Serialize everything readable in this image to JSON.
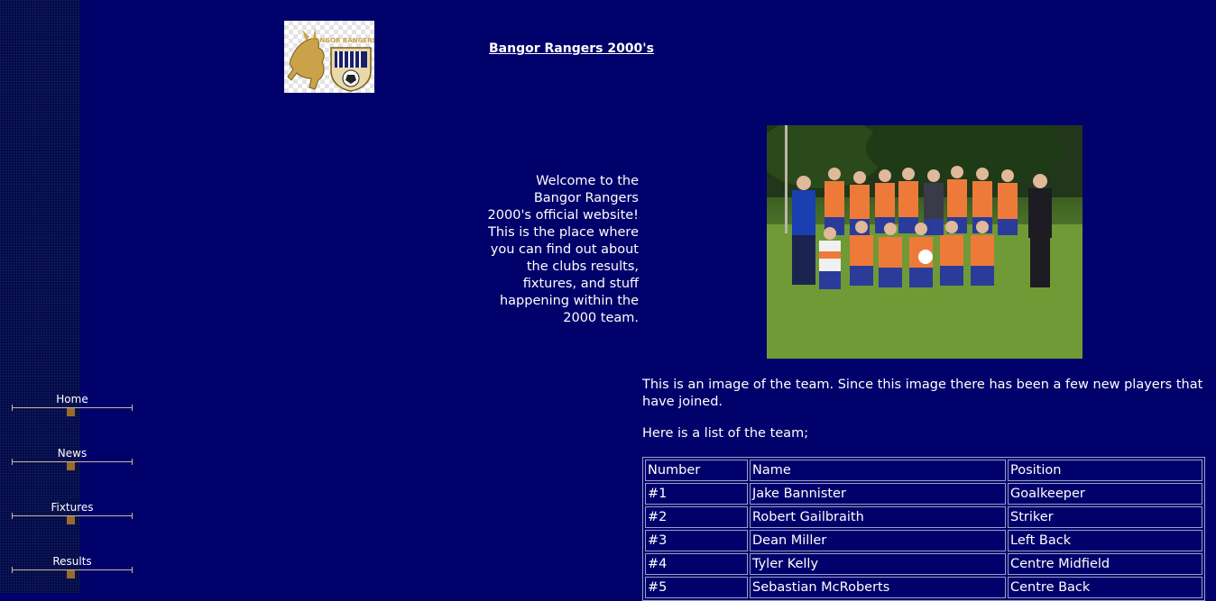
{
  "site": {
    "title": "Bangor Rangers 2000's",
    "logo_name": "bangor-rangers-crest",
    "logo_text": "BANGOR RANGERS F.C."
  },
  "welcome_text": "Welcome to the Bangor Rangers 2000's official website! This is the place where you can find out about the clubs results, fixtures, and stuff happening within the 2000 team.",
  "photo_caption": "This is an image of the team. Since this image there has been a few new players that have joined.",
  "list_intro": "Here is a list of the team;",
  "table": {
    "headers": [
      "Number",
      "Name",
      "Position"
    ],
    "rows": [
      [
        "#1",
        "Jake Bannister",
        "Goalkeeper"
      ],
      [
        "#2",
        "Robert Gailbraith",
        "Striker"
      ],
      [
        "#3",
        "Dean Miller",
        "Left Back"
      ],
      [
        "#4",
        "Tyler Kelly",
        "Centre Midfield"
      ],
      [
        "#5",
        "Sebastian McRoberts",
        "Centre Back"
      ]
    ]
  },
  "nav": [
    {
      "label": "Home"
    },
    {
      "label": "News"
    },
    {
      "label": "Fixtures"
    },
    {
      "label": "Results"
    }
  ],
  "colors": {
    "background": "#01016b",
    "nav_strip": "#020a4a",
    "nav_handle": "#9a6a30",
    "logo_gold": "#c9a24a"
  }
}
